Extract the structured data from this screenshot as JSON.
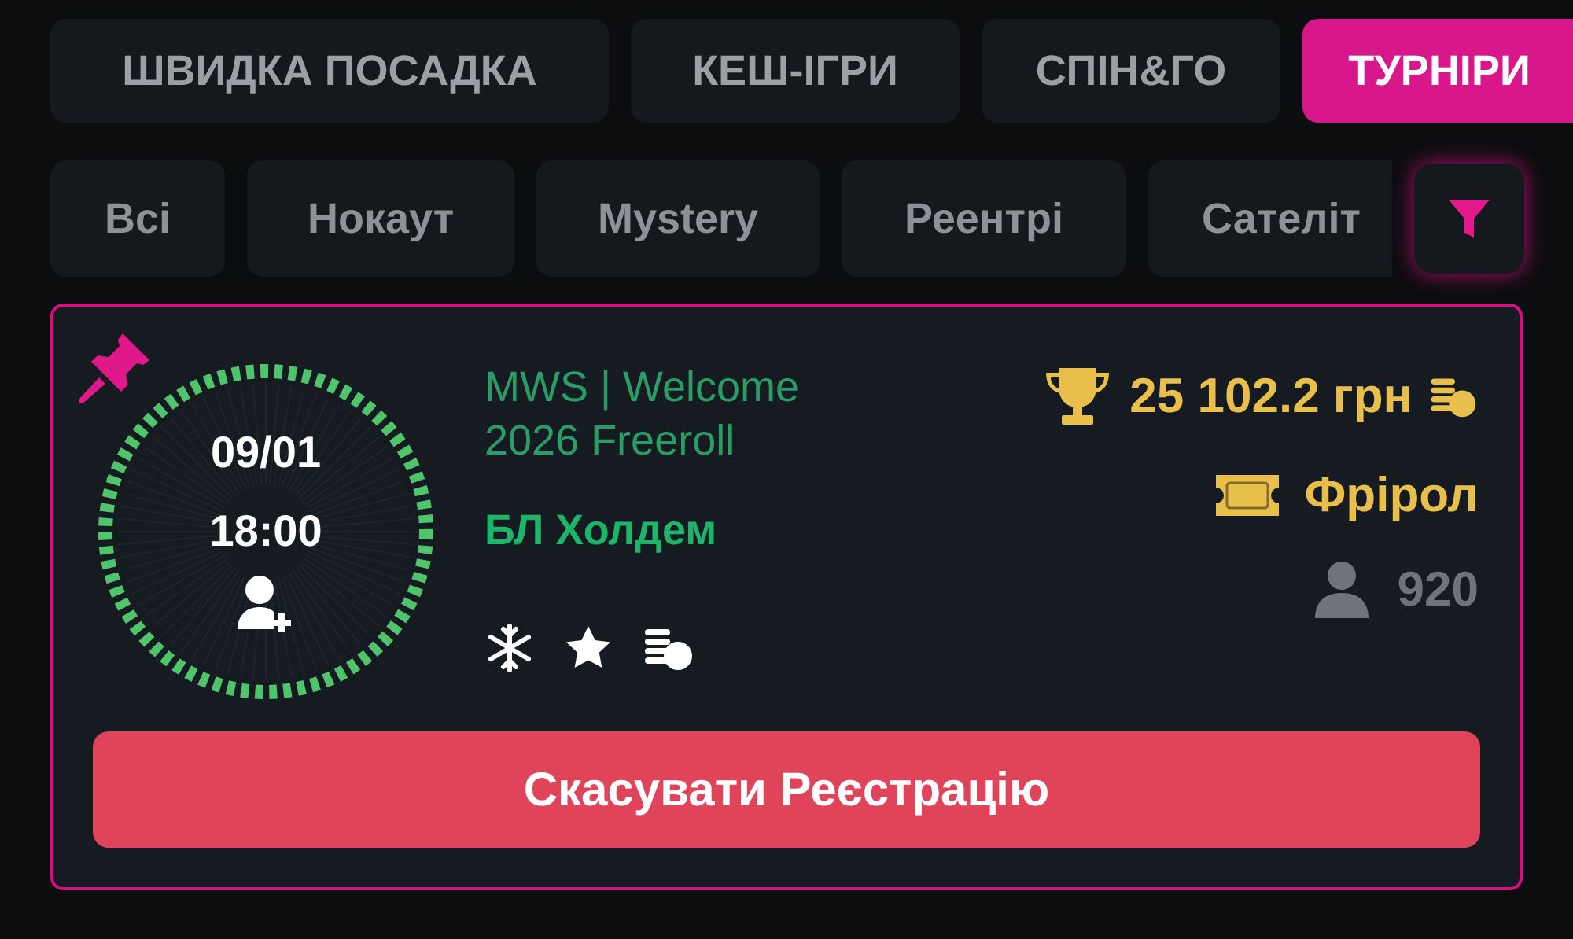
{
  "tabs": [
    {
      "label": "ШВИДКА ПОСАДКА",
      "selected": false
    },
    {
      "label": "КЕШ-ІГРИ",
      "selected": false
    },
    {
      "label": "СПІН&ГО",
      "selected": false
    },
    {
      "label": "ТУРНІРИ",
      "selected": true
    }
  ],
  "filters": [
    "Всі",
    "Нокаут",
    "Mystery",
    "Реентрі",
    "Сателіт"
  ],
  "tournament": {
    "date": "09/01",
    "time": "18:00",
    "name": "MWS | Welcome 2026 Freeroll",
    "game": "БЛ Холдем",
    "prize": "25 102.2 грн",
    "buy_in": "Фрірол",
    "players": "920",
    "action": "Скасувати Реєстрацію"
  }
}
